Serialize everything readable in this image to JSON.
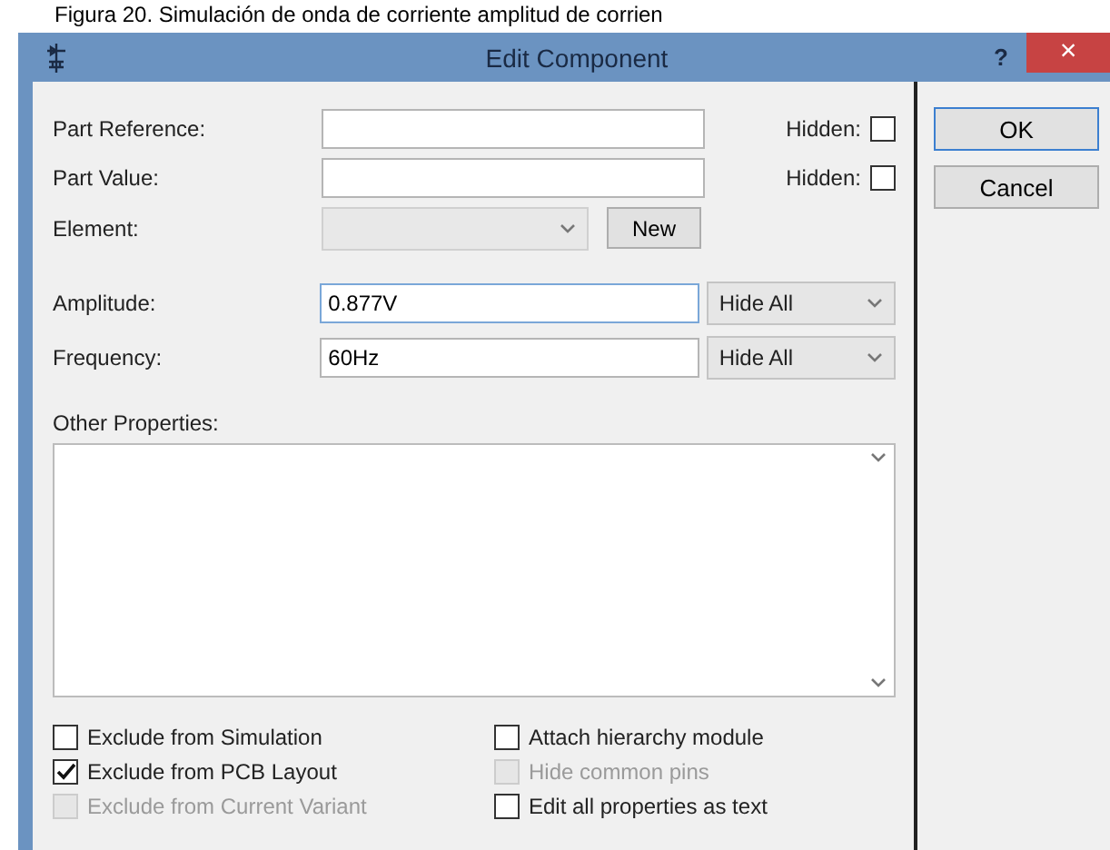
{
  "caption": "Figura 20. Simulación de onda de corriente amplitud de corrien",
  "window": {
    "title": "Edit Component",
    "help": "?",
    "close": "×"
  },
  "fields": [
    {
      "label": "Part Reference:",
      "hidden_label": "Hidden:",
      "hidden": false
    },
    {
      "label": "Part Value:",
      "hidden_label": "Hidden:",
      "hidden": false
    }
  ],
  "element": {
    "label": "Element:",
    "disabled": true,
    "new_button": "New"
  },
  "properties": [
    {
      "label": "Amplitude:",
      "value": "0.877V",
      "focused": true,
      "visibility": "Hide All"
    },
    {
      "label": "Frequency:",
      "value": "60Hz",
      "focused": false,
      "visibility": "Hide All"
    }
  ],
  "other_properties": {
    "label": "Other Properties:"
  },
  "options_left": [
    {
      "label": "Exclude from Simulation",
      "checked": false,
      "disabled": false
    },
    {
      "label": "Exclude from PCB Layout",
      "checked": true,
      "disabled": false
    },
    {
      "label": "Exclude from Current Variant",
      "checked": false,
      "disabled": true
    }
  ],
  "options_right": [
    {
      "label": "Attach hierarchy module",
      "checked": false,
      "disabled": false
    },
    {
      "label": "Hide common pins",
      "checked": false,
      "disabled": true
    },
    {
      "label": "Edit all properties as text",
      "checked": false,
      "disabled": false
    }
  ],
  "buttons": [
    {
      "label": "OK",
      "default": true
    },
    {
      "label": "Cancel",
      "default": false
    }
  ]
}
